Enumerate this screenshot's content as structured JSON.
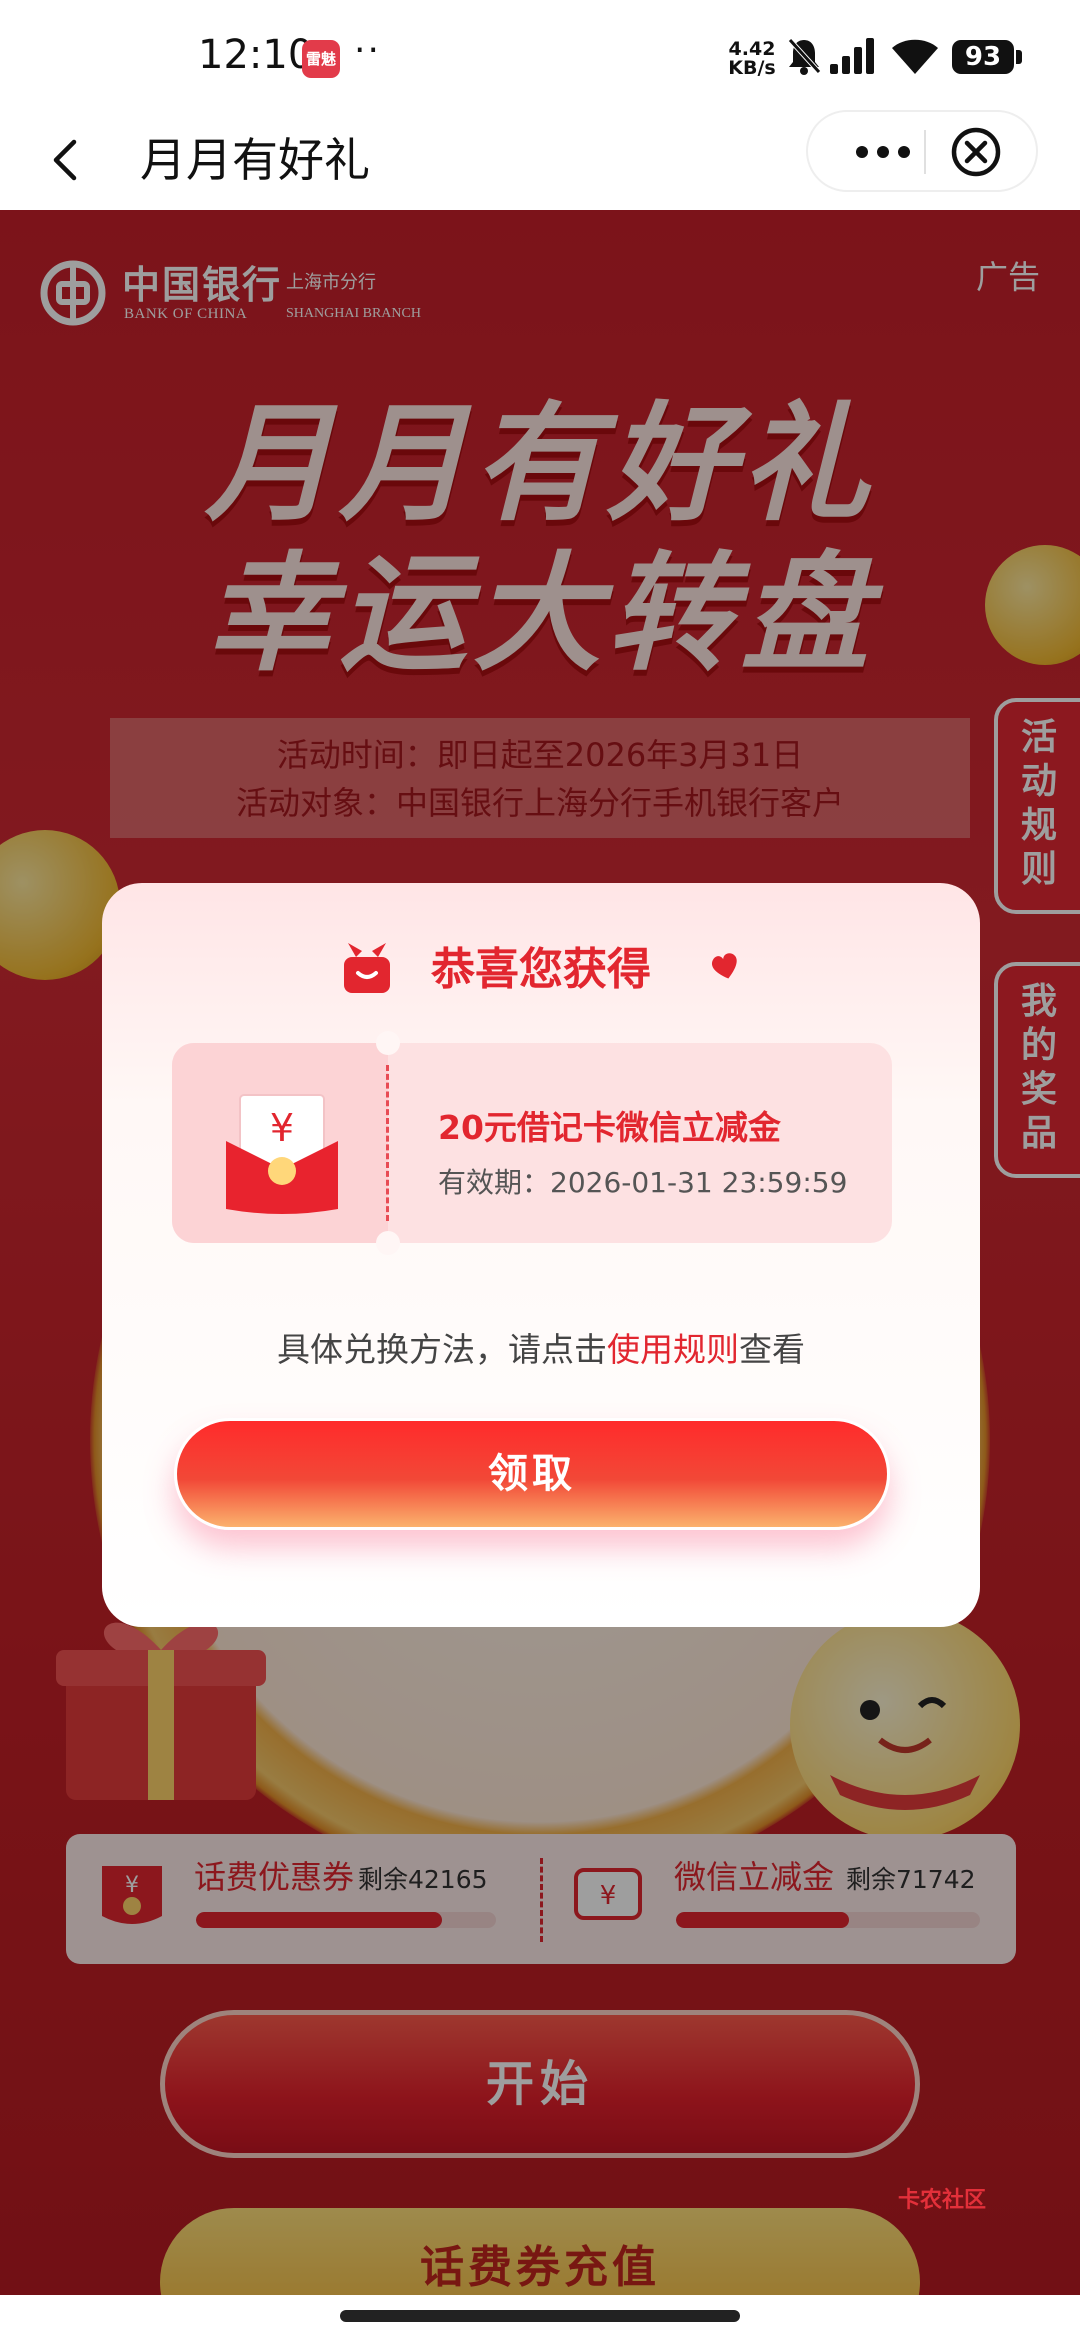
{
  "status_bar": {
    "time": "12:10",
    "app_badge": "雷魅",
    "dots": "··",
    "net_speed_value": "4.42",
    "net_speed_unit": "KB/s",
    "battery": "93",
    "icons": [
      "bell-muted-icon",
      "signal-icon",
      "wifi-icon",
      "battery-icon"
    ]
  },
  "titlebar": {
    "title": "月月有好礼",
    "back_icon": "chevron-left-icon",
    "more_icon": "more-dots-icon",
    "close_icon": "close-circle-icon"
  },
  "banner": {
    "bank_name_cn": "中国银行",
    "bank_name_en": "BANK OF CHINA",
    "branch_cn": "上海市分行",
    "branch_en": "SHANGHAI BRANCH",
    "ad_label": "广告",
    "hero_line1": "月月有好礼",
    "hero_line2": "幸运大转盘",
    "activity_time": "活动时间：即日起至2026年3月31日",
    "activity_target": "活动对象：中国银行上海分行手机银行客户"
  },
  "side_tabs": {
    "rules": "活动规则",
    "my_prizes": "我的奖品"
  },
  "prizes": [
    {
      "label": "话费优惠券",
      "remain": "剩余42165",
      "progress": 0.82
    },
    {
      "label": "微信立减金",
      "remain": "剩余71742",
      "progress": 0.57
    }
  ],
  "buttons": {
    "start": "开始",
    "recharge": "话费券充值"
  },
  "watermark": "卡农社区",
  "modal": {
    "title": "恭喜您获得",
    "coupon_name": "20元借记卡微信立减金",
    "coupon_valid": "有效期：2026-01-31 23:59:59",
    "hint_before": "具体兑换方法，请点击",
    "hint_link": "使用规则",
    "hint_after": "查看",
    "claim": "领取",
    "yen": "¥"
  },
  "colors": {
    "brand_red": "#e2262f",
    "page_red": "#c8202b"
  }
}
